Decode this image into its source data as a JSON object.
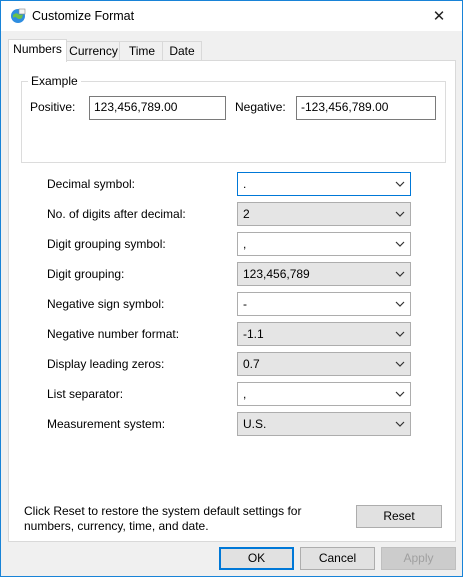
{
  "window": {
    "title": "Customize Format",
    "close_glyph": "✕",
    "app_icon": "regional-settings-icon"
  },
  "tabs": [
    {
      "label": "Numbers",
      "active": true
    },
    {
      "label": "Currency",
      "active": false
    },
    {
      "label": "Time",
      "active": false
    },
    {
      "label": "Date",
      "active": false
    }
  ],
  "example": {
    "legend": "Example",
    "positive_label": "Positive:",
    "positive_value": "123,456,789.00",
    "negative_label": "Negative:",
    "negative_value": "-123,456,789.00"
  },
  "settings": [
    {
      "label": "Decimal symbol:",
      "value": ".",
      "editable": true
    },
    {
      "label": "No. of digits after decimal:",
      "value": "2",
      "editable": false
    },
    {
      "label": "Digit grouping symbol:",
      "value": ",",
      "editable": true
    },
    {
      "label": "Digit grouping:",
      "value": "123,456,789",
      "editable": false
    },
    {
      "label": "Negative sign symbol:",
      "value": "-",
      "editable": true
    },
    {
      "label": "Negative number format:",
      "value": "-1.1",
      "editable": false
    },
    {
      "label": "Display leading zeros:",
      "value": "0.7",
      "editable": false
    },
    {
      "label": "List separator:",
      "value": ",",
      "editable": true
    },
    {
      "label": "Measurement system:",
      "value": "U.S.",
      "editable": false
    }
  ],
  "reset": {
    "text": "Click Reset to restore the system default settings for numbers, currency, time, and date.",
    "button_label": "Reset"
  },
  "buttons": {
    "ok": "OK",
    "cancel": "Cancel",
    "apply": "Apply"
  },
  "colors": {
    "focus_border": "#0078d7",
    "window_border": "#1883d7"
  }
}
